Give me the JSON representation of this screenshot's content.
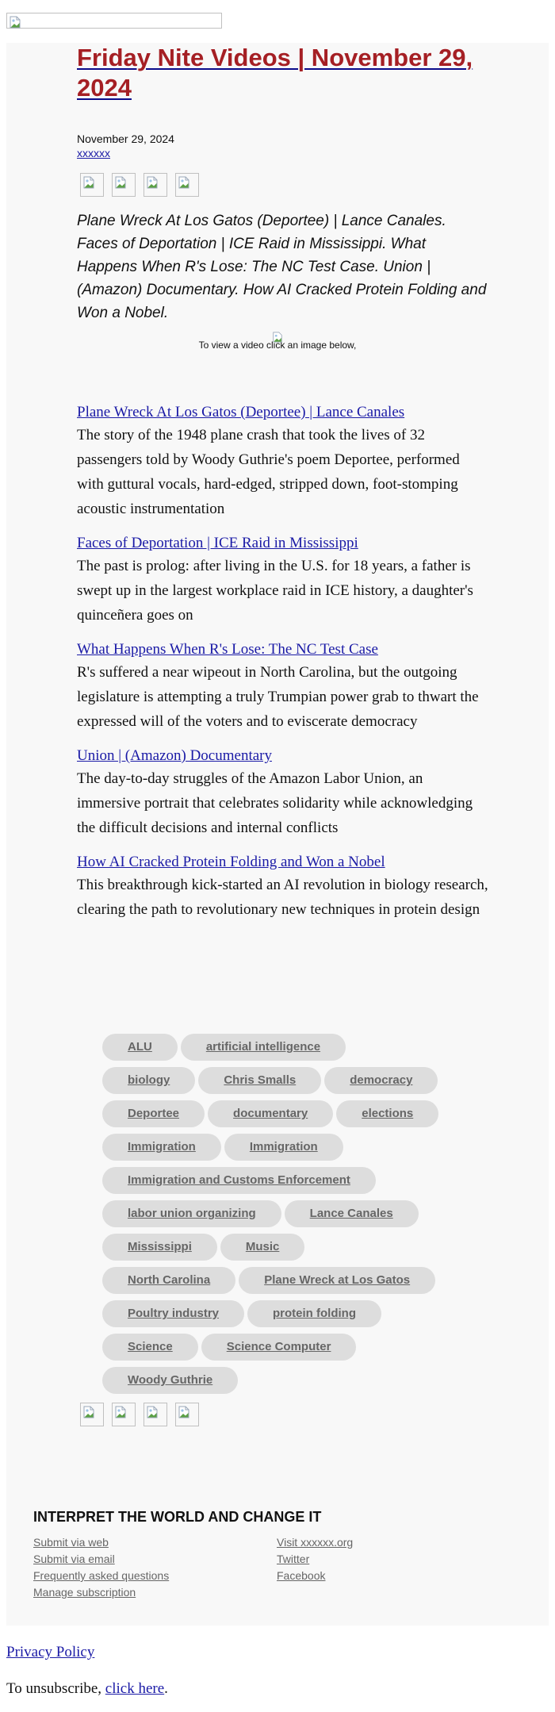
{
  "header": {
    "banner_image": "broken-image-icon"
  },
  "article": {
    "title": "Friday Nite Videos | November 29, 2024",
    "date": "November 29, 2024",
    "author": "xxxxxx",
    "share_icons": [
      "broken-image-icon",
      "broken-image-icon",
      "broken-image-icon",
      "broken-image-icon"
    ],
    "summary": "Plane Wreck At Los Gatos (Deportee) | Lance Canales. Faces of Deportation | ICE Raid in Mississippi. What Happens When R's Lose: The NC Test Case. Union | (Amazon) Documentary. How AI Cracked Protein Folding and Won a Nobel.",
    "video_note": "To view a video click an image below,"
  },
  "stories": [
    {
      "title": "Plane Wreck At Los Gatos (Deportee) | Lance Canales",
      "description": "The story of the 1948 plane crash that took the lives of 32 passengers told by Woody Guthrie's poem Deportee, performed with guttural vocals, hard-edged, stripped down, foot-stomping acoustic instrumentation"
    },
    {
      "title": "Faces of Deportation | ICE Raid in Mississippi",
      "description": "The past is prolog: after living in the U.S. for 18 years, a father is swept up in the largest workplace raid in ICE history, a daughter's quinceñera goes on"
    },
    {
      "title": "What Happens When R's Lose: The NC Test Case",
      "description": "R's suffered a near wipeout in North Carolina, but the outgoing legislature is attempting a truly Trumpian power grab to thwart the expressed will of the voters and to eviscerate democracy"
    },
    {
      "title": "Union | (Amazon) Documentary",
      "description": "The day-to-day struggles of the Amazon Labor Union, an immersive portrait that celebrates solidarity while acknowledging the difficult decisions and internal conflicts"
    },
    {
      "title": "How AI Cracked Protein Folding and Won a Nobel",
      "description": "This breakthrough kick-started an AI revolution in biology research, clearing the path to revolutionary new techniques in protein design"
    }
  ],
  "tags": [
    "ALU",
    "artificial intelligence",
    "biology",
    "Chris Smalls",
    "democracy",
    "Deportee",
    "documentary",
    "elections",
    "Immigration",
    "Immigration",
    "Immigration and Customs Enforcement",
    "labor union organizing",
    "Lance Canales",
    "Mississippi",
    "Music",
    "North Carolina",
    "Plane Wreck at Los Gatos",
    "Poultry industry",
    "protein folding",
    "Science",
    "Science Computer",
    "Woody Guthrie"
  ],
  "tag_rows": [
    [
      0,
      1
    ],
    [
      2,
      3,
      4
    ],
    [
      5,
      6,
      7
    ],
    [
      8,
      9
    ],
    [
      10
    ],
    [
      11,
      12
    ],
    [
      13,
      14
    ],
    [
      15,
      16
    ],
    [
      17,
      18
    ],
    [
      19,
      20
    ],
    [
      21
    ]
  ],
  "footer": {
    "heading": "INTERPRET THE WORLD AND CHANGE IT",
    "left_links": [
      "Submit via web",
      "Submit via email",
      "Frequently asked questions",
      "Manage subscription"
    ],
    "right_links": [
      "Visit xxxxxx.org",
      "Twitter",
      "Facebook"
    ]
  },
  "legal": {
    "privacy_policy": "Privacy Policy",
    "unsubscribe_prefix": "To unsubscribe, ",
    "unsubscribe_link": "click here",
    "unsubscribe_suffix": "."
  },
  "colors": {
    "title": "#a51f24",
    "link": "#1a1aa6",
    "tag_bg": "#dddddd",
    "tag_text": "#666666",
    "panel_bg": "#f8f8f8"
  }
}
